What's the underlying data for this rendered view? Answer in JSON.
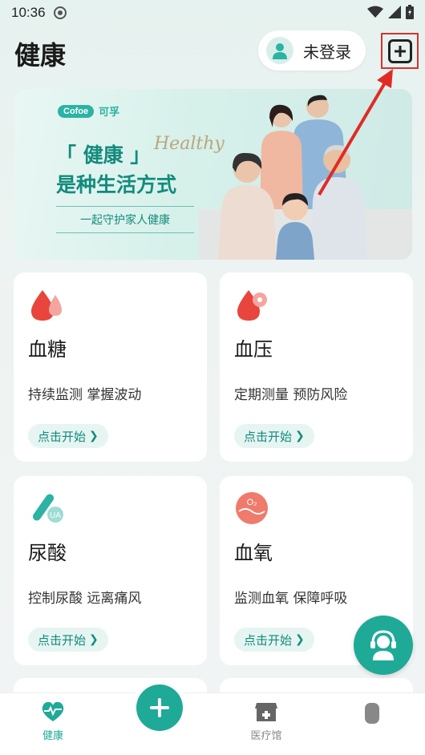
{
  "status_bar": {
    "time": "10:36"
  },
  "header": {
    "title": "健康",
    "login_label": "未登录"
  },
  "banner": {
    "brand_logo": "Cofoe",
    "brand_cn": "可孚",
    "headline_line1": "「 健康 」",
    "script_text": "Healthy",
    "headline_line2": "是种生活方式",
    "tagline": "一起守护家人健康"
  },
  "cards": [
    {
      "title": "血糖",
      "desc": "持续监测 掌握波动",
      "button": "点击开始",
      "icon": "blood-drop-icon"
    },
    {
      "title": "血压",
      "desc": "定期测量 预防风险",
      "button": "点击开始",
      "icon": "blood-pressure-icon"
    },
    {
      "title": "尿酸",
      "desc": "控制尿酸 远离痛风",
      "button": "点击开始",
      "icon": "uric-acid-icon",
      "icon_text": "UA"
    },
    {
      "title": "血氧",
      "desc": "监测血氧 保障呼吸",
      "button": "点击开始",
      "icon": "blood-oxygen-icon",
      "icon_text": "O₂"
    }
  ],
  "tabbar": {
    "items": [
      {
        "label": "健康",
        "icon": "heart-pulse-icon",
        "active": true
      },
      {
        "label": "医疗馆",
        "icon": "clinic-icon",
        "active": false
      },
      {
        "label": "",
        "icon": "profile-icon",
        "active": false
      }
    ]
  },
  "colors": {
    "accent": "#1faa98",
    "accent_text": "#138b7c",
    "highlight": "#d9302c"
  }
}
